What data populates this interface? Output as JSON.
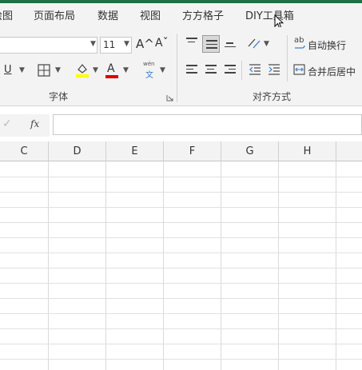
{
  "menu_tabs": [
    "绘图",
    "页面布局",
    "数据",
    "视图",
    "方方格子",
    "DIY工具箱"
  ],
  "font_group": {
    "label": "字体",
    "font_size": "11",
    "grow_font_icon": "A^",
    "shrink_font_icon": "Aˇ",
    "underline_label": "U",
    "font_color_label": "A",
    "phonetic_top": "wén",
    "phonetic_bottom": "文",
    "highlight_color": "#ffff00",
    "font_color": "#e00000"
  },
  "alignment_group": {
    "label": "对齐方式",
    "wrap_text": "自动换行",
    "merge_center": "合并后居中",
    "wrap_icon_text": "ab"
  },
  "formula_bar": {
    "check_icon": "✓",
    "fx": "fx",
    "value": ""
  },
  "columns": [
    "C",
    "D",
    "E",
    "F",
    "G",
    "H"
  ]
}
